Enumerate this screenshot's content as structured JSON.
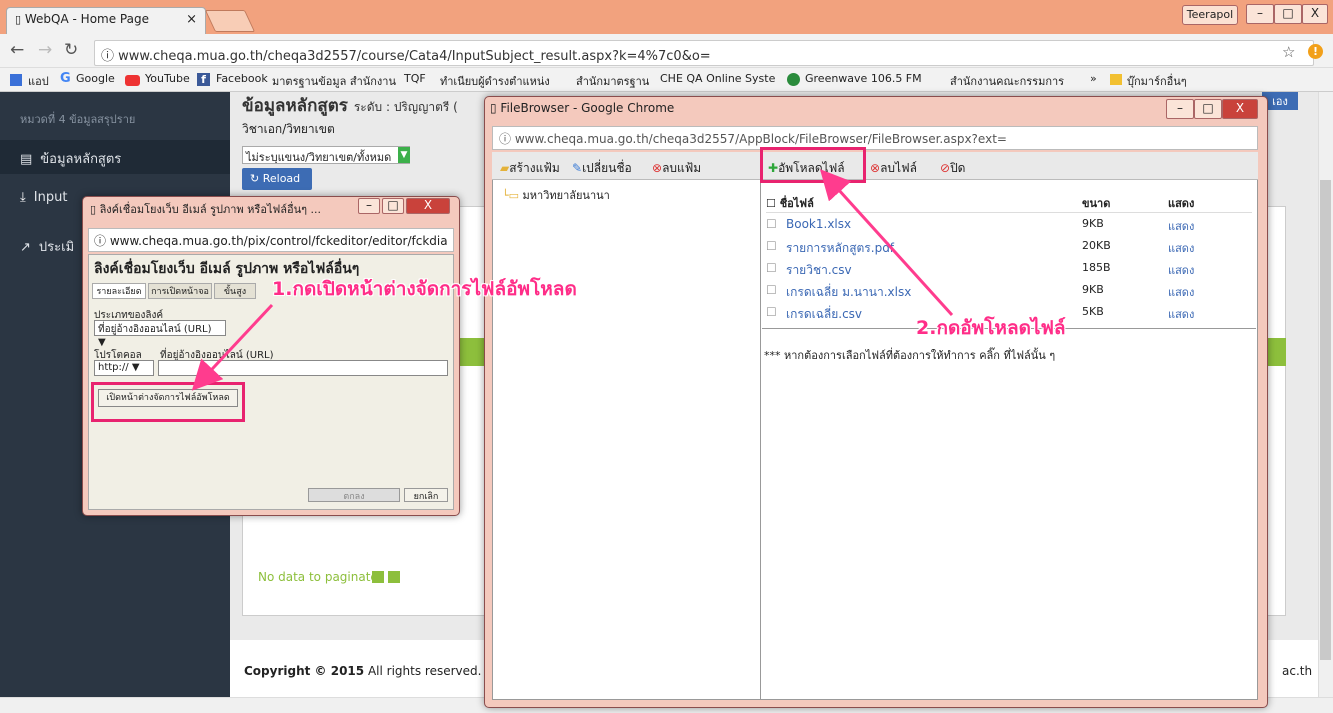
{
  "browser": {
    "tab_title": "WebQA - Home Page",
    "tab_close": "×",
    "user": "Teerapol",
    "address": "ⓘ www.cheqa.mua.go.th/cheqa3d2557/course/Cata4/InputSubject_result.aspx?k=4%7c0&o=",
    "bookmarks": [
      "แอป",
      "Google",
      "YouTube",
      "Facebook",
      "มาตรฐานข้อมูล สำนักงาน",
      "TQF",
      "ทำเนียบผู้ดำรงตำแหน่ง",
      "สำนักมาตรฐาน",
      "CHE QA Online Syste",
      "Greenwave 106.5 FM",
      "สำนักงานคณะกรรมการ",
      "»",
      "บุ๊กมาร์กอื่นๆ"
    ]
  },
  "page": {
    "sidebar_header": "หมวดที่ 4 ข้อมูลสรุปราย",
    "sidebar_items": [
      "ข้อมูลหลักสูตร",
      "Input",
      "ประเมิ"
    ],
    "title": "ข้อมูลหลักสูตร",
    "title_level": "ระดับ : ปริญญาตรี (",
    "subtitle": "วิชาเอก/วิทยาเขต",
    "select_value": "ไม่ระบุแขนง/วิทยาเขต/ทั้งหมด",
    "reload": "Reload",
    "paginate": "No data to paginate",
    "copyright_bold": "Copyright © 2015",
    "copyright_rest": " All rights reserved.",
    "right_badge": "เอง",
    "footer_right": "ac.th"
  },
  "dialog1": {
    "title": "ลิงค์เชื่อมโยงเว็บ อีเมล์ รูปภาพ หรือไฟล์อื่นๆ ...",
    "address": "ⓘ www.cheqa.mua.go.th/pix/control/fckeditor/editor/fckdia",
    "heading": "ลิงค์เชื่อมโยงเว็บ อีเมล์ รูปภาพ หรือไฟล์อื่นๆ",
    "tabs": [
      "รายละเอียด",
      "การเปิดหน้าจอ",
      "ขั้นสูง"
    ],
    "link_type_label": "ประเภทของลิงค์",
    "link_type_value": "ที่อยู่อ้างอิงออนไลน์ (URL)",
    "protocol_label": "โปรโตคอล",
    "url_label": "ที่อยู่อ้างอิงออนไลน์ (URL)",
    "protocol_value": "http://",
    "open_browser_btn": "เปิดหน้าต่างจัดการไฟล์อัพโหลด",
    "ok": "ตกลง",
    "cancel": "ยกเลิก"
  },
  "dialog2": {
    "title": "FileBrowser - Google Chrome",
    "address": "ⓘ www.cheqa.mua.go.th/cheqa3d2557/AppBlock/FileBrowser/FileBrowser.aspx?ext=",
    "left_toolbar": [
      "สร้างแฟ้ม",
      "เปลี่ยนชื่อ",
      "ลบแฟ้ม"
    ],
    "right_toolbar": [
      "อัพโหลดไฟล์",
      "ลบไฟล์",
      "ปิด"
    ],
    "folder": "มหาวิทยาลัยนานา",
    "col_name": "ชื่อไฟล์",
    "col_size": "ขนาด",
    "col_show": "แสดง",
    "files": [
      {
        "name": "Book1.xlsx",
        "size": "9KB",
        "show": "แสดง"
      },
      {
        "name": "รายการหลักสูตร.pdf",
        "size": "20KB",
        "show": "แสดง"
      },
      {
        "name": "รายวิชา.csv",
        "size": "185B",
        "show": "แสดง"
      },
      {
        "name": "เกรดเฉลี่ย ม.นานา.xlsx",
        "size": "9KB",
        "show": "แสดง"
      },
      {
        "name": "เกรดเฉลี่ย.csv",
        "size": "5KB",
        "show": "แสดง"
      }
    ],
    "note": "*** หากต้องการเลือกไฟล์ที่ต้องการให้ทำการ คลิ๊ก ที่ไฟล์นั้น ๆ"
  },
  "annotations": {
    "step1": "1.กดเปิดหน้าต่างจัดการไฟล์อัพโหลด",
    "step2": "2.กดอัพโหลดไฟล์"
  },
  "colors": {
    "highlight": "#e8236f",
    "sidebar": "#2b3643",
    "window_frame": "#f4c9bd"
  }
}
